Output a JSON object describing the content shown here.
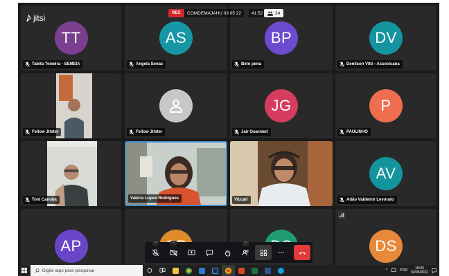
{
  "app": {
    "logo": "jitsi"
  },
  "topbar": {
    "rec_label": "REC",
    "room_name": "COMDEMAJAHU 03 05 22",
    "timer": "41:52",
    "participant_count": "24"
  },
  "tiles": [
    {
      "name": "Tabita Teixeira - SEMEIA",
      "initials": "TT",
      "color": "#7b3f8f"
    },
    {
      "name": "Angela Senac",
      "initials": "AS",
      "color": "#1797a6"
    },
    {
      "name": "Beto pena",
      "initials": "BP",
      "color": "#6c4bd1"
    },
    {
      "name": "Denilson Vitti - Associcana",
      "initials": "DV",
      "color": "#13949e"
    },
    {
      "name": "Fellow Jitster",
      "initials": "",
      "color": ""
    },
    {
      "name": "Fellow Jitster",
      "initials": "",
      "color": "#c7c7c7"
    },
    {
      "name": "Jair Guarnieri",
      "initials": "JG",
      "color": "#d63c5e"
    },
    {
      "name": "PAULINHO",
      "initials": "P",
      "color": "#ef6e4f"
    },
    {
      "name": "Toni Canoba",
      "initials": "",
      "color": ""
    },
    {
      "name": "Valéria Lopes Rodrigues",
      "initials": "",
      "color": ""
    },
    {
      "name": "Viccari",
      "initials": "",
      "color": ""
    },
    {
      "name": "Adão Valdemir Levorato",
      "initials": "AV",
      "color": "#13949e"
    },
    {
      "name": "",
      "initials": "AP",
      "color": "#6b45c8"
    },
    {
      "name": "",
      "initials": "CP",
      "color": "#e08a2c"
    },
    {
      "name": "",
      "initials": "DS",
      "color": "#1f9c74"
    },
    {
      "name": "",
      "initials": "DS",
      "color": "#e8893a"
    }
  ],
  "toolbar": {
    "buttons": [
      "mic-muted",
      "camera-off",
      "share-screen",
      "chat",
      "raise-hand",
      "participants",
      "tile-view",
      "more"
    ],
    "more_label": "···"
  },
  "taskbar": {
    "search_placeholder": "Digite aqui para pesquisar",
    "lang": "POR",
    "time": "18:03",
    "date": "03/05/2022"
  },
  "colors": {
    "hangup": "#e03a3e",
    "rec": "#d2282d",
    "active_border": "#3e8bd1"
  }
}
